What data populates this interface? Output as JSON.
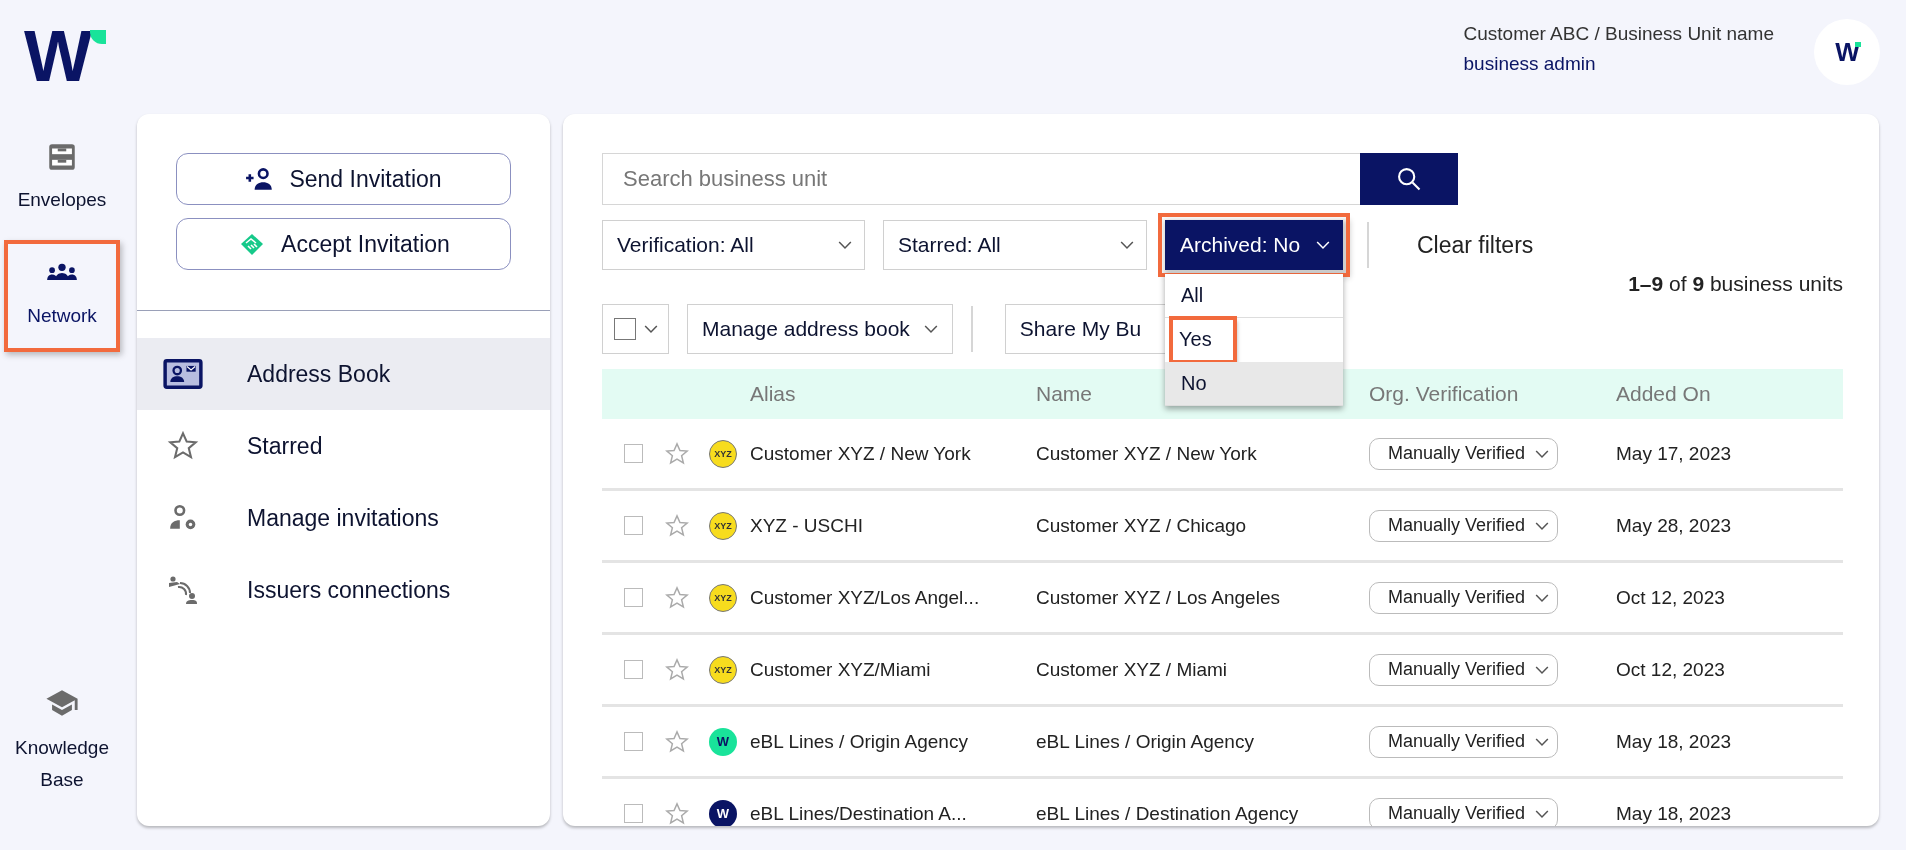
{
  "logo": {
    "text": "W"
  },
  "rail": [
    {
      "label": "Envelopes",
      "kind": "envelopes",
      "selected": false,
      "highlighted": false
    },
    {
      "label": "Network",
      "kind": "network",
      "selected": true,
      "highlighted": true
    }
  ],
  "rail_bottom": {
    "label": "Knowledge Base",
    "kind": "knowledge"
  },
  "user": {
    "org": "Customer ABC / Business Unit name",
    "role": "business admin",
    "avatar": "W"
  },
  "actions": [
    {
      "label": "Send Invitation",
      "kind": "send"
    },
    {
      "label": "Accept Invitation",
      "kind": "accept"
    }
  ],
  "sidebar": {
    "items": [
      {
        "label": "Address Book",
        "kind": "book",
        "selected": true
      },
      {
        "label": "Starred",
        "kind": "star",
        "selected": false
      },
      {
        "label": "Manage invitations",
        "kind": "manage",
        "selected": false
      },
      {
        "label": "Issuers connections",
        "kind": "issuers",
        "selected": false
      }
    ]
  },
  "search": {
    "placeholder": "Search business unit"
  },
  "filters": [
    {
      "label": "Verification: All",
      "active": false,
      "highlighted": false
    },
    {
      "label": "Starred: All",
      "active": false,
      "highlighted": false
    },
    {
      "label": "Archived: No",
      "active": true,
      "highlighted": true
    }
  ],
  "clear_filters": "Clear filters",
  "archived_menu": [
    {
      "label": "All",
      "selected": false,
      "highlighted": false
    },
    {
      "label": "Yes",
      "selected": false,
      "highlighted": true
    },
    {
      "label": "No",
      "selected": true,
      "highlighted": false
    }
  ],
  "count": "**1–9** of **9** business units",
  "toolbar": {
    "select_all_checked": false,
    "manage": "Manage address book",
    "share": "Share My Bu"
  },
  "table": {
    "columns": [
      "Alias",
      "Name",
      "Org. Verification",
      "Added On"
    ],
    "rows": [
      {
        "checked": false,
        "starred": false,
        "logo": {
          "kind": "xyz",
          "text": "XYZ"
        },
        "alias": "Customer XYZ / New York",
        "name": "Customer XYZ / New York",
        "verification": "Manually Verified",
        "added": "May 17, 2023"
      },
      {
        "checked": false,
        "starred": false,
        "logo": {
          "kind": "xyz",
          "text": "XYZ"
        },
        "alias": "XYZ - USCHI",
        "name": "Customer XYZ / Chicago",
        "verification": "Manually Verified",
        "added": "May 28, 2023"
      },
      {
        "checked": false,
        "starred": false,
        "logo": {
          "kind": "xyz",
          "text": "XYZ"
        },
        "alias": "Customer XYZ/Los Angel...",
        "name": "Customer XYZ / Los Angeles",
        "verification": "Manually Verified",
        "added": "Oct 12, 2023"
      },
      {
        "checked": false,
        "starred": false,
        "logo": {
          "kind": "xyz",
          "text": "XYZ"
        },
        "alias": "Customer XYZ/Miami",
        "name": "Customer XYZ / Miami",
        "verification": "Manually Verified",
        "added": "Oct 12, 2023"
      },
      {
        "checked": false,
        "starred": false,
        "logo": {
          "kind": "w-green",
          "text": "W"
        },
        "alias": "eBL Lines / Origin Agency",
        "name": "eBL Lines / Origin Agency",
        "verification": "Manually Verified",
        "added": "May 18, 2023"
      },
      {
        "checked": false,
        "starred": false,
        "logo": {
          "kind": "w-navy",
          "text": "W"
        },
        "alias": "eBL Lines/Destination A...",
        "name": "eBL Lines / Destination Agency",
        "verification": "Manually Verified",
        "added": "May 18, 2023"
      }
    ]
  }
}
